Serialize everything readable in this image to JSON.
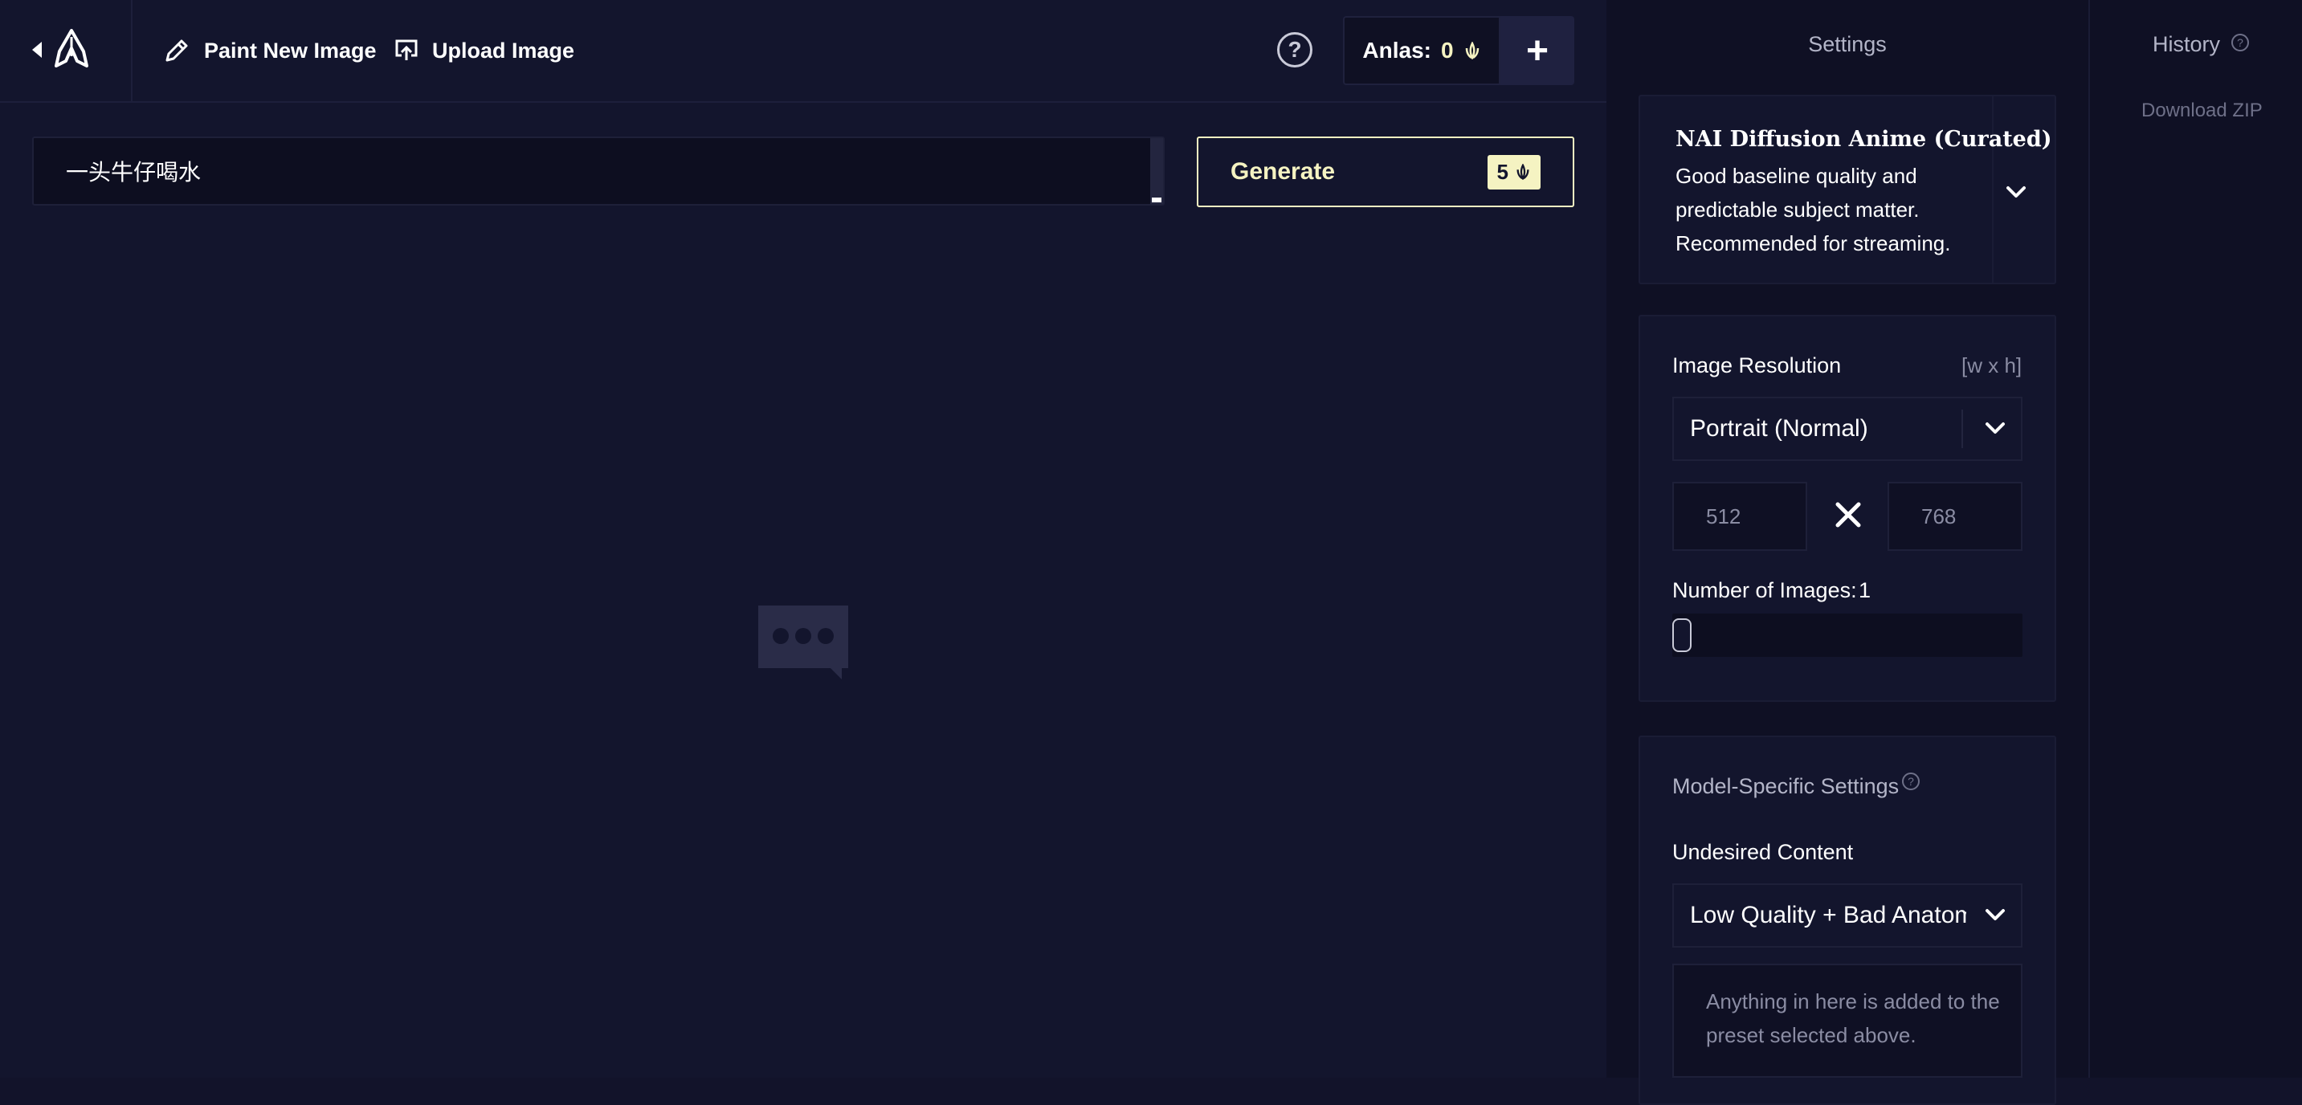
{
  "toolbar": {
    "paint_label": "Paint New Image",
    "upload_label": "Upload Image",
    "help_glyph": "?",
    "anlas_label": "Anlas:",
    "anlas_value": "0",
    "add_glyph": "+"
  },
  "prompt": {
    "value": "一头牛仔喝水"
  },
  "generate": {
    "label": "Generate",
    "cost": "5"
  },
  "settings": {
    "title": "Settings",
    "model": {
      "name": "NAI Diffusion Anime (Curated)",
      "description": "Good baseline quality and predictable subject matter. Recommended for streaming."
    },
    "resolution": {
      "label": "Image Resolution",
      "hint": "[w x h]",
      "selected": "Portrait (Normal)",
      "width": "512",
      "height": "768"
    },
    "images": {
      "label": "Number of Images:",
      "value": "1"
    },
    "model_specific": {
      "label": "Model-Specific Settings",
      "undesired_label": "Undesired Content",
      "undesired_selected": "Low Quality + Bad Anatomy",
      "undesired_placeholder": "Anything in here is added to the preset selected above."
    }
  },
  "history": {
    "title": "History",
    "download_label": "Download ZIP"
  },
  "colors": {
    "accent": "#f5f3c2",
    "background": "#13152d",
    "panel": "#0f1024"
  }
}
